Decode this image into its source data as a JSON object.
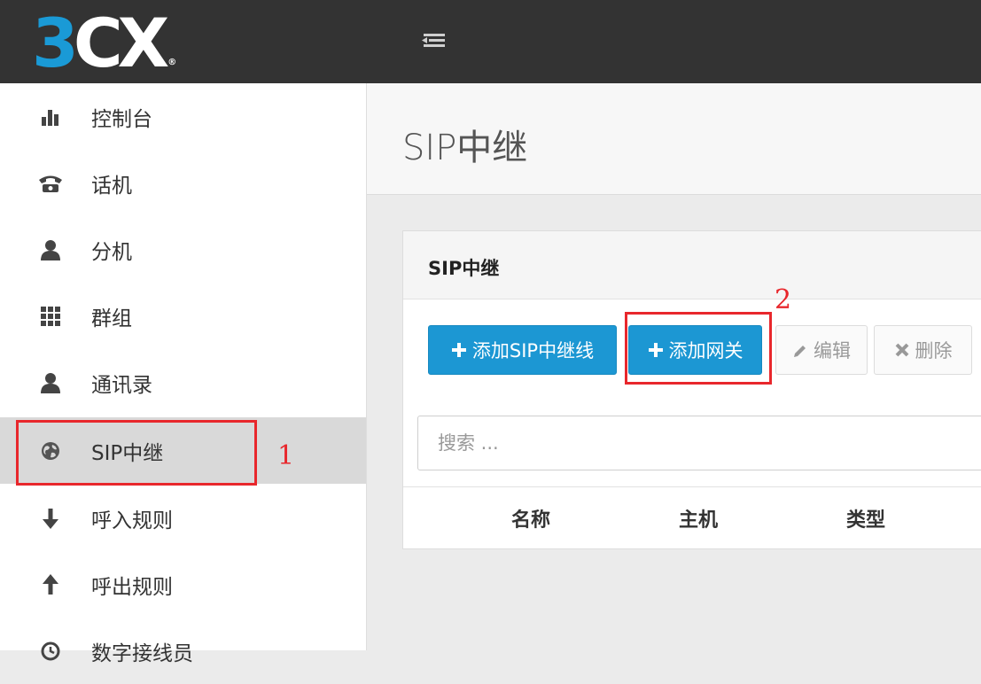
{
  "app": {
    "logo_prefix": "3",
    "logo_suffix": "CX",
    "logo_reg": "®"
  },
  "sidebar": {
    "items": [
      {
        "label": "控制台",
        "icon": "bar-chart-icon"
      },
      {
        "label": "话机",
        "icon": "phone-icon"
      },
      {
        "label": "分机",
        "icon": "user-icon"
      },
      {
        "label": "群组",
        "icon": "grid-icon"
      },
      {
        "label": "通讯录",
        "icon": "user-icon"
      },
      {
        "label": "SIP中继",
        "icon": "globe-icon",
        "active": true
      },
      {
        "label": "呼入规则",
        "icon": "arrow-down-icon"
      },
      {
        "label": "呼出规则",
        "icon": "arrow-up-icon"
      },
      {
        "label": "数字接线员",
        "icon": "clock-icon"
      }
    ]
  },
  "main": {
    "page_title": "SIP中继",
    "panel_title": "SIP中继",
    "toolbar": {
      "add_trunk": "添加SIP中继线",
      "add_gateway": "添加网关",
      "edit": "编辑",
      "delete": "删除"
    },
    "search": {
      "placeholder": "搜索 ..."
    },
    "table": {
      "columns": [
        "名称",
        "主机",
        "类型"
      ]
    }
  },
  "annotations": {
    "marker_1": "1",
    "marker_2": "2",
    "color": "#e8272c"
  },
  "colors": {
    "topbar": "#333333",
    "brand_blue": "#1c97d3",
    "active_nav": "#d9d9d9"
  }
}
